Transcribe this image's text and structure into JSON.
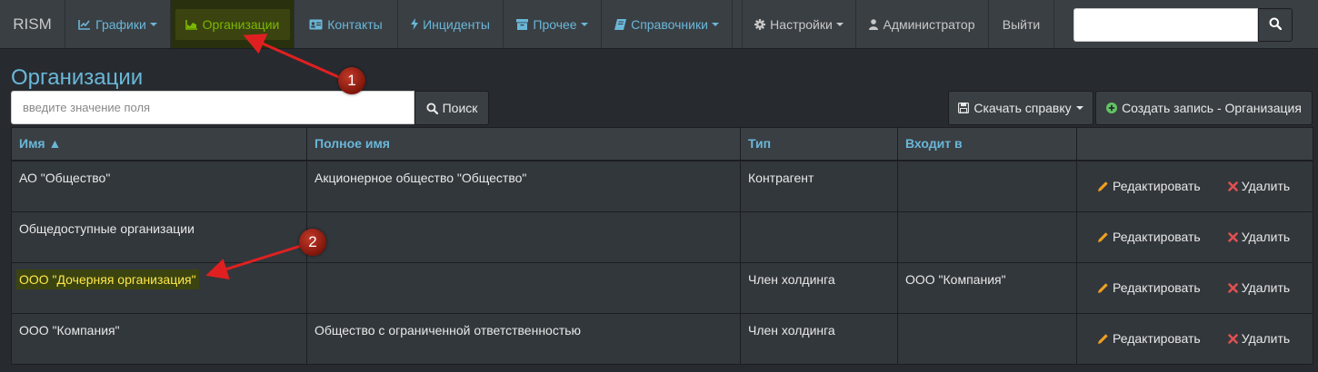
{
  "navbar": {
    "brand": "RISM",
    "items": [
      {
        "label": "Графики",
        "icon": "chart-line-icon",
        "dropdown": true
      },
      {
        "label": "Организации",
        "icon": "chart-area-icon",
        "dropdown": false,
        "active": true
      },
      {
        "label": "Контакты",
        "icon": "id-card-icon",
        "dropdown": false
      },
      {
        "label": "Инциденты",
        "icon": "bolt-icon",
        "dropdown": false
      },
      {
        "label": "Прочее",
        "icon": "archive-icon",
        "dropdown": true
      },
      {
        "label": "Справочники",
        "icon": "book-icon",
        "dropdown": true
      },
      {
        "label": "Настройки",
        "icon": "gear-icon",
        "dropdown": true
      },
      {
        "label": "Администратор",
        "icon": "user-icon",
        "dropdown": false
      },
      {
        "label": "Выйти",
        "icon": "",
        "dropdown": false
      }
    ],
    "search": {
      "value": "",
      "placeholder": ""
    }
  },
  "page": {
    "title": "Организации",
    "filter": {
      "placeholder": "введите значение поля",
      "value": ""
    },
    "search_button": "Поиск",
    "download_button": "Скачать справку",
    "create_button": "Создать запись - Организация"
  },
  "table": {
    "columns": [
      "Имя ▲",
      "Полное имя",
      "Тип",
      "Входит в",
      ""
    ],
    "rows": [
      {
        "name": "АО \"Общество\"",
        "full_name": "Акционерное общество \"Общество\"",
        "type": "Контрагент",
        "parent": ""
      },
      {
        "name": "Общедоступные организации",
        "full_name": "",
        "type": "",
        "parent": ""
      },
      {
        "name": "ООО \"Дочерняя организация\"",
        "full_name": "",
        "type": "Член холдинга",
        "parent": "ООО \"Компания\"",
        "highlighted": true
      },
      {
        "name": "ООО \"Компания\"",
        "full_name": "Общество с ограниченной ответственностью",
        "type": "Член холдинга",
        "parent": ""
      }
    ],
    "edit_label": "Редактировать",
    "delete_label": "Удалить"
  },
  "annotations": [
    {
      "number": "1"
    },
    {
      "number": "2"
    }
  ],
  "colors": {
    "background": "#272b30",
    "navbar": "#3a3f44",
    "link_accent": "#6ab7d8",
    "active_nav_text": "#7bb800",
    "highlight_text": "#ffe74a",
    "edit_icon": "#f0a020",
    "delete_icon": "#e05050",
    "create_icon": "#62c462",
    "annotation_red": "#e02020"
  }
}
